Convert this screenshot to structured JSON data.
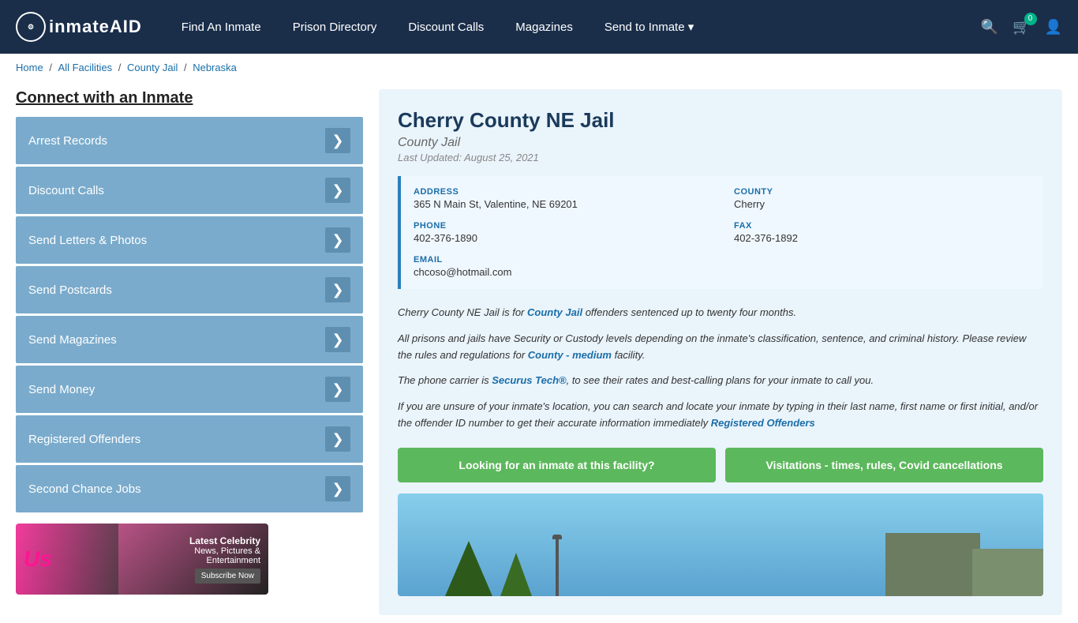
{
  "navbar": {
    "logo_text": "inmateAID",
    "links": [
      {
        "label": "Find An Inmate",
        "id": "find-inmate"
      },
      {
        "label": "Prison Directory",
        "id": "prison-directory"
      },
      {
        "label": "Discount Calls",
        "id": "discount-calls"
      },
      {
        "label": "Magazines",
        "id": "magazines"
      },
      {
        "label": "Send to Inmate ▾",
        "id": "send-to-inmate"
      }
    ],
    "cart_count": "0"
  },
  "breadcrumb": {
    "items": [
      "Home",
      "All Facilities",
      "County Jail",
      "Nebraska"
    ]
  },
  "sidebar": {
    "title": "Connect with an Inmate",
    "menu_items": [
      {
        "label": "Arrest Records"
      },
      {
        "label": "Discount Calls"
      },
      {
        "label": "Send Letters & Photos"
      },
      {
        "label": "Send Postcards"
      },
      {
        "label": "Send Magazines"
      },
      {
        "label": "Send Money"
      },
      {
        "label": "Registered Offenders"
      },
      {
        "label": "Second Chance Jobs"
      }
    ],
    "ad": {
      "logo": "Us",
      "headline": "Latest Celebrity",
      "line2": "News, Pictures &",
      "line3": "Entertainment",
      "button": "Subscribe Now"
    }
  },
  "facility": {
    "name": "Cherry County NE Jail",
    "type": "County Jail",
    "last_updated": "Last Updated: August 25, 2021",
    "address_label": "ADDRESS",
    "address_value": "365 N Main St, Valentine, NE 69201",
    "county_label": "COUNTY",
    "county_value": "Cherry",
    "phone_label": "PHONE",
    "phone_value": "402-376-1890",
    "fax_label": "FAX",
    "fax_value": "402-376-1892",
    "email_label": "EMAIL",
    "email_value": "chcoso@hotmail.com",
    "desc1": "Cherry County NE Jail is for County Jail offenders sentenced up to twenty four months.",
    "desc2": "All prisons and jails have Security or Custody levels depending on the inmate's classification, sentence, and criminal history. Please review the rules and regulations for County - medium facility.",
    "desc3": "The phone carrier is Securus Tech®, to see their rates and best-calling plans for your inmate to call you.",
    "desc4": "If you are unsure of your inmate's location, you can search and locate your inmate by typing in their last name, first name or first initial, and/or the offender ID number to get their accurate information immediately Registered Offenders",
    "btn_find": "Looking for an inmate at this facility?",
    "btn_visit": "Visitations - times, rules, Covid cancellations"
  }
}
